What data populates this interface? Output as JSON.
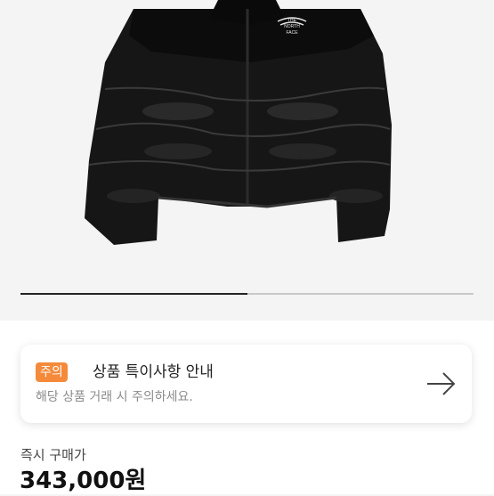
{
  "product": {
    "image_name": "black-puffer-jacket",
    "brand_logo_lines": [
      "THE",
      "NORTH",
      "FACE"
    ],
    "carousel_progress": 0.5
  },
  "notice": {
    "badge": "주의",
    "title": "상품 특이사항 안내",
    "subtitle": "해당 상품 거래 시 주의하세요.",
    "arrow_icon": "arrow-right-icon"
  },
  "price": {
    "label": "즉시 구매가",
    "value": "343,000원"
  },
  "colors": {
    "badge": "#f48a3a",
    "page_bg": "#f4f4f4",
    "card_bg": "#ffffff"
  }
}
